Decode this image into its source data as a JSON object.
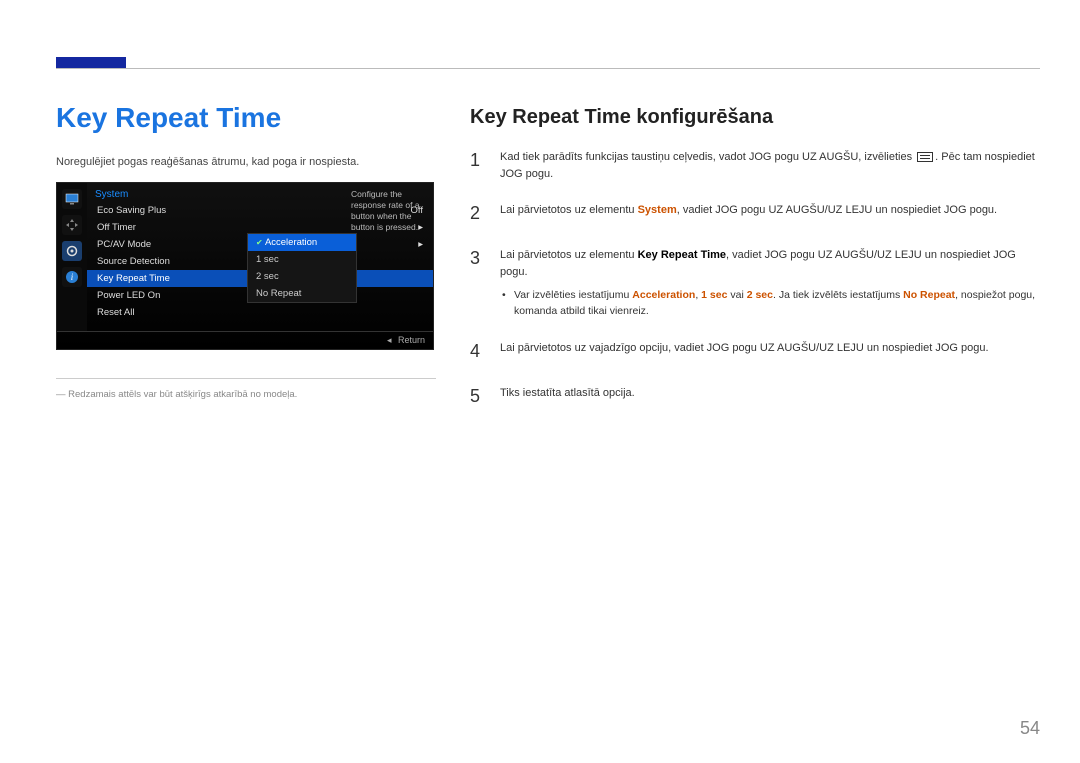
{
  "header": {
    "title": "Key Repeat Time"
  },
  "left": {
    "description": "Noregulējiet pogas reaģēšanas ātrumu, kad poga ir nospiesta.",
    "osd": {
      "heading": "System",
      "tip": "Configure the response rate of a button when the button is pressed.",
      "items": [
        {
          "label": "Eco Saving Plus",
          "value": "Off"
        },
        {
          "label": "Off Timer",
          "value": "▸"
        },
        {
          "label": "PC/AV Mode",
          "value": "▸"
        },
        {
          "label": "Source Detection",
          "value": ""
        },
        {
          "label": "Key Repeat Time",
          "value": "",
          "selected": true
        },
        {
          "label": "Power LED On",
          "value": ""
        },
        {
          "label": "Reset All",
          "value": ""
        }
      ],
      "sub": [
        {
          "label": "Acceleration",
          "selected": true
        },
        {
          "label": "1 sec"
        },
        {
          "label": "2 sec"
        },
        {
          "label": "No Repeat"
        }
      ],
      "footer": {
        "back": "◂",
        "return": "Return"
      }
    },
    "footnote": "Redzamais attēls var būt atšķirīgs atkarībā no modeļa."
  },
  "right": {
    "title": "Key Repeat Time konfigurēšana",
    "steps": [
      {
        "num": "1",
        "pre": "Kad tiek parādīts funkcijas taustiņu ceļvedis, vadot JOG pogu UZ AUGŠU, izvēlieties ",
        "post": ". Pēc tam nospiediet JOG pogu.",
        "has_icon": true
      },
      {
        "num": "2",
        "parts": [
          "Lai pārvietotos uz elementu ",
          {
            "kw": "System"
          },
          ", vadiet JOG pogu UZ AUGŠU/UZ LEJU un nospiediet JOG pogu."
        ]
      },
      {
        "num": "3",
        "parts": [
          "Lai pārvietotos uz elementu ",
          {
            "kb": "Key Repeat Time"
          },
          ", vadiet JOG pogu UZ AUGŠU/UZ LEJU un nospiediet JOG pogu."
        ],
        "sub": {
          "parts": [
            "Var izvēlēties iestatījumu ",
            {
              "kw": "Acceleration"
            },
            ", ",
            {
              "kw": "1 sec"
            },
            " vai ",
            {
              "kw": "2 sec"
            },
            ". Ja tiek izvēlēts iestatījums ",
            {
              "kw": "No Repeat"
            },
            ", nospiežot pogu, komanda atbild tikai vienreiz."
          ]
        }
      },
      {
        "num": "4",
        "text": "Lai pārvietotos uz vajadzīgo opciju, vadiet JOG pogu UZ AUGŠU/UZ LEJU un nospiediet JOG pogu."
      },
      {
        "num": "5",
        "text": "Tiks iestatīta atlasītā opcija."
      }
    ]
  },
  "page_number": "54"
}
